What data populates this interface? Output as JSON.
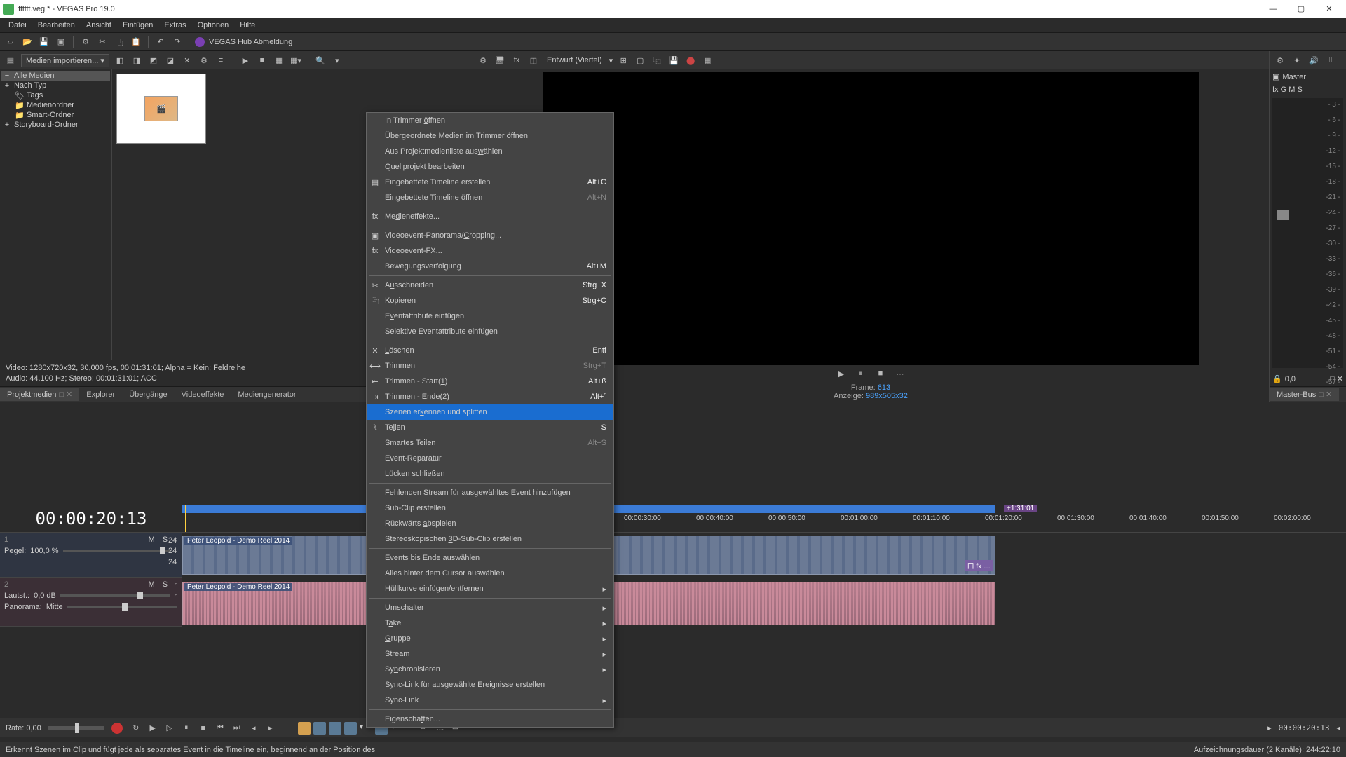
{
  "window": {
    "title": "ffffff.veg * - VEGAS Pro 19.0"
  },
  "menu": {
    "items": [
      "Datei",
      "Bearbeiten",
      "Ansicht",
      "Einfügen",
      "Extras",
      "Optionen",
      "Hilfe"
    ]
  },
  "toolbar": {
    "hub": "VEGAS Hub Abmeldung"
  },
  "mediaToolbar": {
    "import": "Medien importieren..."
  },
  "tree": {
    "items": [
      {
        "label": "Alle Medien",
        "sel": true,
        "indent": 0,
        "expander": "-"
      },
      {
        "label": "Nach Typ",
        "indent": 0,
        "expander": "+"
      },
      {
        "label": "Tags",
        "indent": 1
      },
      {
        "label": "Medienordner",
        "indent": 1
      },
      {
        "label": "Smart-Ordner",
        "indent": 1
      },
      {
        "label": "Storyboard-Ordner",
        "indent": 0,
        "expander": "+"
      }
    ]
  },
  "mediaInfo": {
    "video": "Video: 1280x720x32, 30,000 fps, 00:01:31:01; Alpha = Kein; Feldreihe",
    "audio": "Audio: 44.100 Hz; Stereo; 00:01:31:01; ACC"
  },
  "panelTabs": [
    "Projektmedien",
    "Explorer",
    "Übergänge",
    "Videoeffekte",
    "Mediengenerator"
  ],
  "preview": {
    "quality": "Entwurf (Viertel)",
    "frame_lbl": "Frame:",
    "frame_val": "613",
    "display_lbl": "Anzeige:",
    "display_val": "989x505x32"
  },
  "master": {
    "title": "Master",
    "controls": "fx   G   M   S",
    "scale": [
      "- 3 -",
      "- 6 -",
      "- 9 -",
      "-12 -",
      "-15 -",
      "-18 -",
      "-21 -",
      "-24 -",
      "-27 -",
      "-30 -",
      "-33 -",
      "-36 -",
      "-39 -",
      "-42 -",
      "-45 -",
      "-48 -",
      "-51 -",
      "-54 -",
      "-57 -"
    ],
    "value": "0,0",
    "tab": "Master-Bus"
  },
  "timecode": "00:00:20:13",
  "ruler": [
    "00:00:30:00",
    "00:00:40:00",
    "00:00:50:00",
    "00:01:00:00",
    "00:01:10:00",
    "00:01:20:00",
    "00:01:30:00",
    "00:01:40:00",
    "00:01:50:00",
    "00:02:00:00"
  ],
  "endMarker": "+1:31:01",
  "track1": {
    "num": "1",
    "label": "Pegel:",
    "value": "100,0 %",
    "ms": "M   S"
  },
  "track2": {
    "num": "2",
    "label_v": "Lautst.:",
    "value_v": "0,0 dB",
    "label_p": "Panorama:",
    "value_p": "Mitte",
    "ms": "M   S"
  },
  "clip": {
    "name": "Peter Leopold - Demo Reel 2014",
    "fx": "口  fx  …"
  },
  "trackAux": {
    "a": "24",
    "b": "24",
    "c": "24"
  },
  "footer": {
    "rate": "Rate: 0,00",
    "tc": "00:00:20:13",
    "record": "Aufzeichnungsdauer (2 Kanäle): 244:22:10"
  },
  "status": "Erkennt Szenen im Clip und fügt jede als separates Event in die Timeline ein, beginnend an der Position des",
  "ctx": {
    "open_trimmer": "In Trimmer öffnen",
    "parent_media": "Übergeordnete Medien im Trimmer öffnen",
    "select_project": "Aus Projektmedienliste auswählen",
    "edit_source": "Quellprojekt bearbeiten",
    "nest_create": "Eingebettete Timeline erstellen",
    "nest_create_sc": "Alt+C",
    "nest_open": "Eingebettete Timeline öffnen",
    "nest_open_sc": "Alt+N",
    "media_fx": "Medieneffekte...",
    "pan_crop": "Videoevent-Panorama/Cropping...",
    "event_fx": "Videoevent-FX...",
    "motion": "Bewegungsverfolgung",
    "motion_sc": "Alt+M",
    "cut": "Ausschneiden",
    "cut_sc": "Strg+X",
    "copy": "Kopieren",
    "copy_sc": "Strg+C",
    "paste_attr": "Eventattribute einfügen",
    "paste_sel_attr": "Selektive Eventattribute einfügen",
    "delete": "Löschen",
    "delete_sc": "Entf",
    "trim": "Trimmen",
    "trim_sc": "Strg+T",
    "trim_start": "Trimmen - Start(1)",
    "trim_start_sc": "Alt+ß",
    "trim_end": "Trimmen - Ende(2)",
    "trim_end_sc": "Alt+´",
    "scene_detect": "Szenen erkennen und splitten",
    "split": "Teilen",
    "split_sc": "S",
    "smart_split": "Smartes Teilen",
    "smart_split_sc": "Alt+S",
    "repair": "Event-Reparatur",
    "close_gaps": "Lücken schließen",
    "add_stream": "Fehlenden Stream für ausgewähltes Event hinzufügen",
    "subclip": "Sub-Clip erstellen",
    "reverse": "Rückwärts abspielen",
    "stereo3d": "Stereoskopischen 3D-Sub-Clip erstellen",
    "select_end": "Events bis Ende auswählen",
    "select_after": "Alles hinter dem Cursor auswählen",
    "envelope": "Hüllkurve einfügen/entfernen",
    "switches": "Umschalter",
    "take": "Take",
    "group": "Gruppe",
    "stream": "Stream",
    "sync": "Synchronisieren",
    "synclink_create": "Sync-Link für ausgewählte Ereignisse erstellen",
    "synclink": "Sync-Link",
    "props": "Eigenschaften..."
  }
}
